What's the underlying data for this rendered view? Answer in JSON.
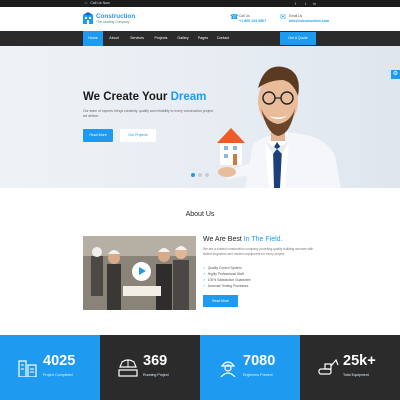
{
  "topbar": {
    "phone_icon": "phone-icon",
    "phone": "Call Us Now",
    "social": [
      "f",
      "t",
      "in"
    ]
  },
  "brand": {
    "name": "Construction",
    "tagline": "The Leading Company",
    "contacts": [
      {
        "icon": "phone-icon",
        "line1": "Call Us",
        "line2": "+1 800 123 4567"
      },
      {
        "icon": "mail-icon",
        "line1": "Email Us",
        "line2": "info@construction.com"
      }
    ]
  },
  "nav": {
    "items": [
      "Home",
      "About",
      "Services",
      "Projects",
      "Gallery",
      "Pages",
      "Contact"
    ],
    "active_index": 0,
    "quote_label": "Get A Quote"
  },
  "hero": {
    "title_main": "We Create Your",
    "title_highlight": "Dream",
    "subtitle": "Our team of experts brings creativity, quality and reliability to every construction project we deliver.",
    "btn_primary": "Read More",
    "btn_secondary": "Our Projects",
    "slide_count": 3,
    "active_slide": 0
  },
  "about": {
    "section_title": "About Us",
    "heading_main": "We Are Best",
    "heading_highlight": "In The Field.",
    "paragraph": "We are a trusted construction company providing quality building services with skilled engineers and modern equipment for every project.",
    "points": [
      "Quality Control System",
      "Highly Professional Staff",
      "100% Satisfaction Guarantee",
      "Accurate Testing Processes"
    ],
    "button": "Read More"
  },
  "stats": [
    {
      "icon": "buildings-icon",
      "number": "4025",
      "label": "Project Completed",
      "color": "#1e9bf0"
    },
    {
      "icon": "worker-icon",
      "number": "369",
      "label": "Running Project",
      "color": "#2b2b2b"
    },
    {
      "icon": "engineer-icon",
      "number": "7080",
      "label": "Engineers Present",
      "color": "#1e9bf0"
    },
    {
      "icon": "excavator-icon",
      "number": "25k+",
      "label": "Total Equipment",
      "color": "#2b2b2b"
    }
  ],
  "colors": {
    "accent": "#1e9bf0",
    "dark": "#2b2b2b"
  }
}
